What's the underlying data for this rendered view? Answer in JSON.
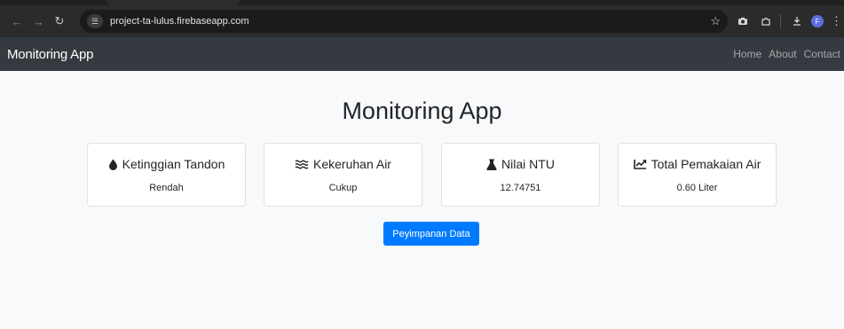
{
  "browser": {
    "url": "project-ta-lulus.firebaseapp.com",
    "profile_initial": "F"
  },
  "navbar": {
    "brand": "Monitoring App",
    "links": [
      "Home",
      "About",
      "Contact"
    ]
  },
  "main": {
    "title": "Monitoring App",
    "cards": [
      {
        "icon": "droplet-icon",
        "label": "Ketinggian Tandon",
        "value": "Rendah"
      },
      {
        "icon": "water-waves-icon",
        "label": "Kekeruhan Air",
        "value": "Cukup"
      },
      {
        "icon": "flask-icon",
        "label": "Nilai NTU",
        "value": "12.74751"
      },
      {
        "icon": "line-chart-icon",
        "label": "Total Pemakaian Air",
        "value": "0.60 Liter"
      }
    ],
    "button_label": "Peyimpanan Data"
  },
  "colors": {
    "navbar_bg": "#343a40",
    "primary": "#007bff",
    "page_bg": "#f8f9fa"
  }
}
